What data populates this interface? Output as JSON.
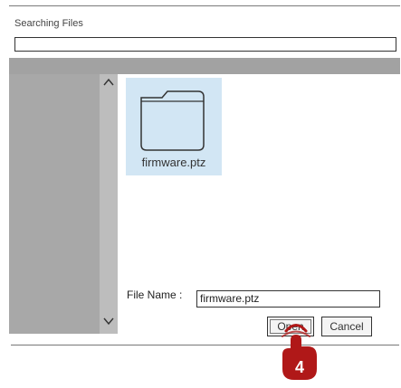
{
  "search": {
    "title": "Searching Files",
    "value": ""
  },
  "file": {
    "name": "firmware.ptz",
    "icon": "folder-icon"
  },
  "form": {
    "file_name_label": "File Name :",
    "file_name_value": "firmware.ptz"
  },
  "buttons": {
    "open_label": "Open",
    "cancel_label": "Cancel"
  },
  "step": {
    "number": "4"
  },
  "colors": {
    "tile": "#d2e6f4",
    "accent": "#b01818",
    "dialog_gray": "#b8b8b8"
  }
}
